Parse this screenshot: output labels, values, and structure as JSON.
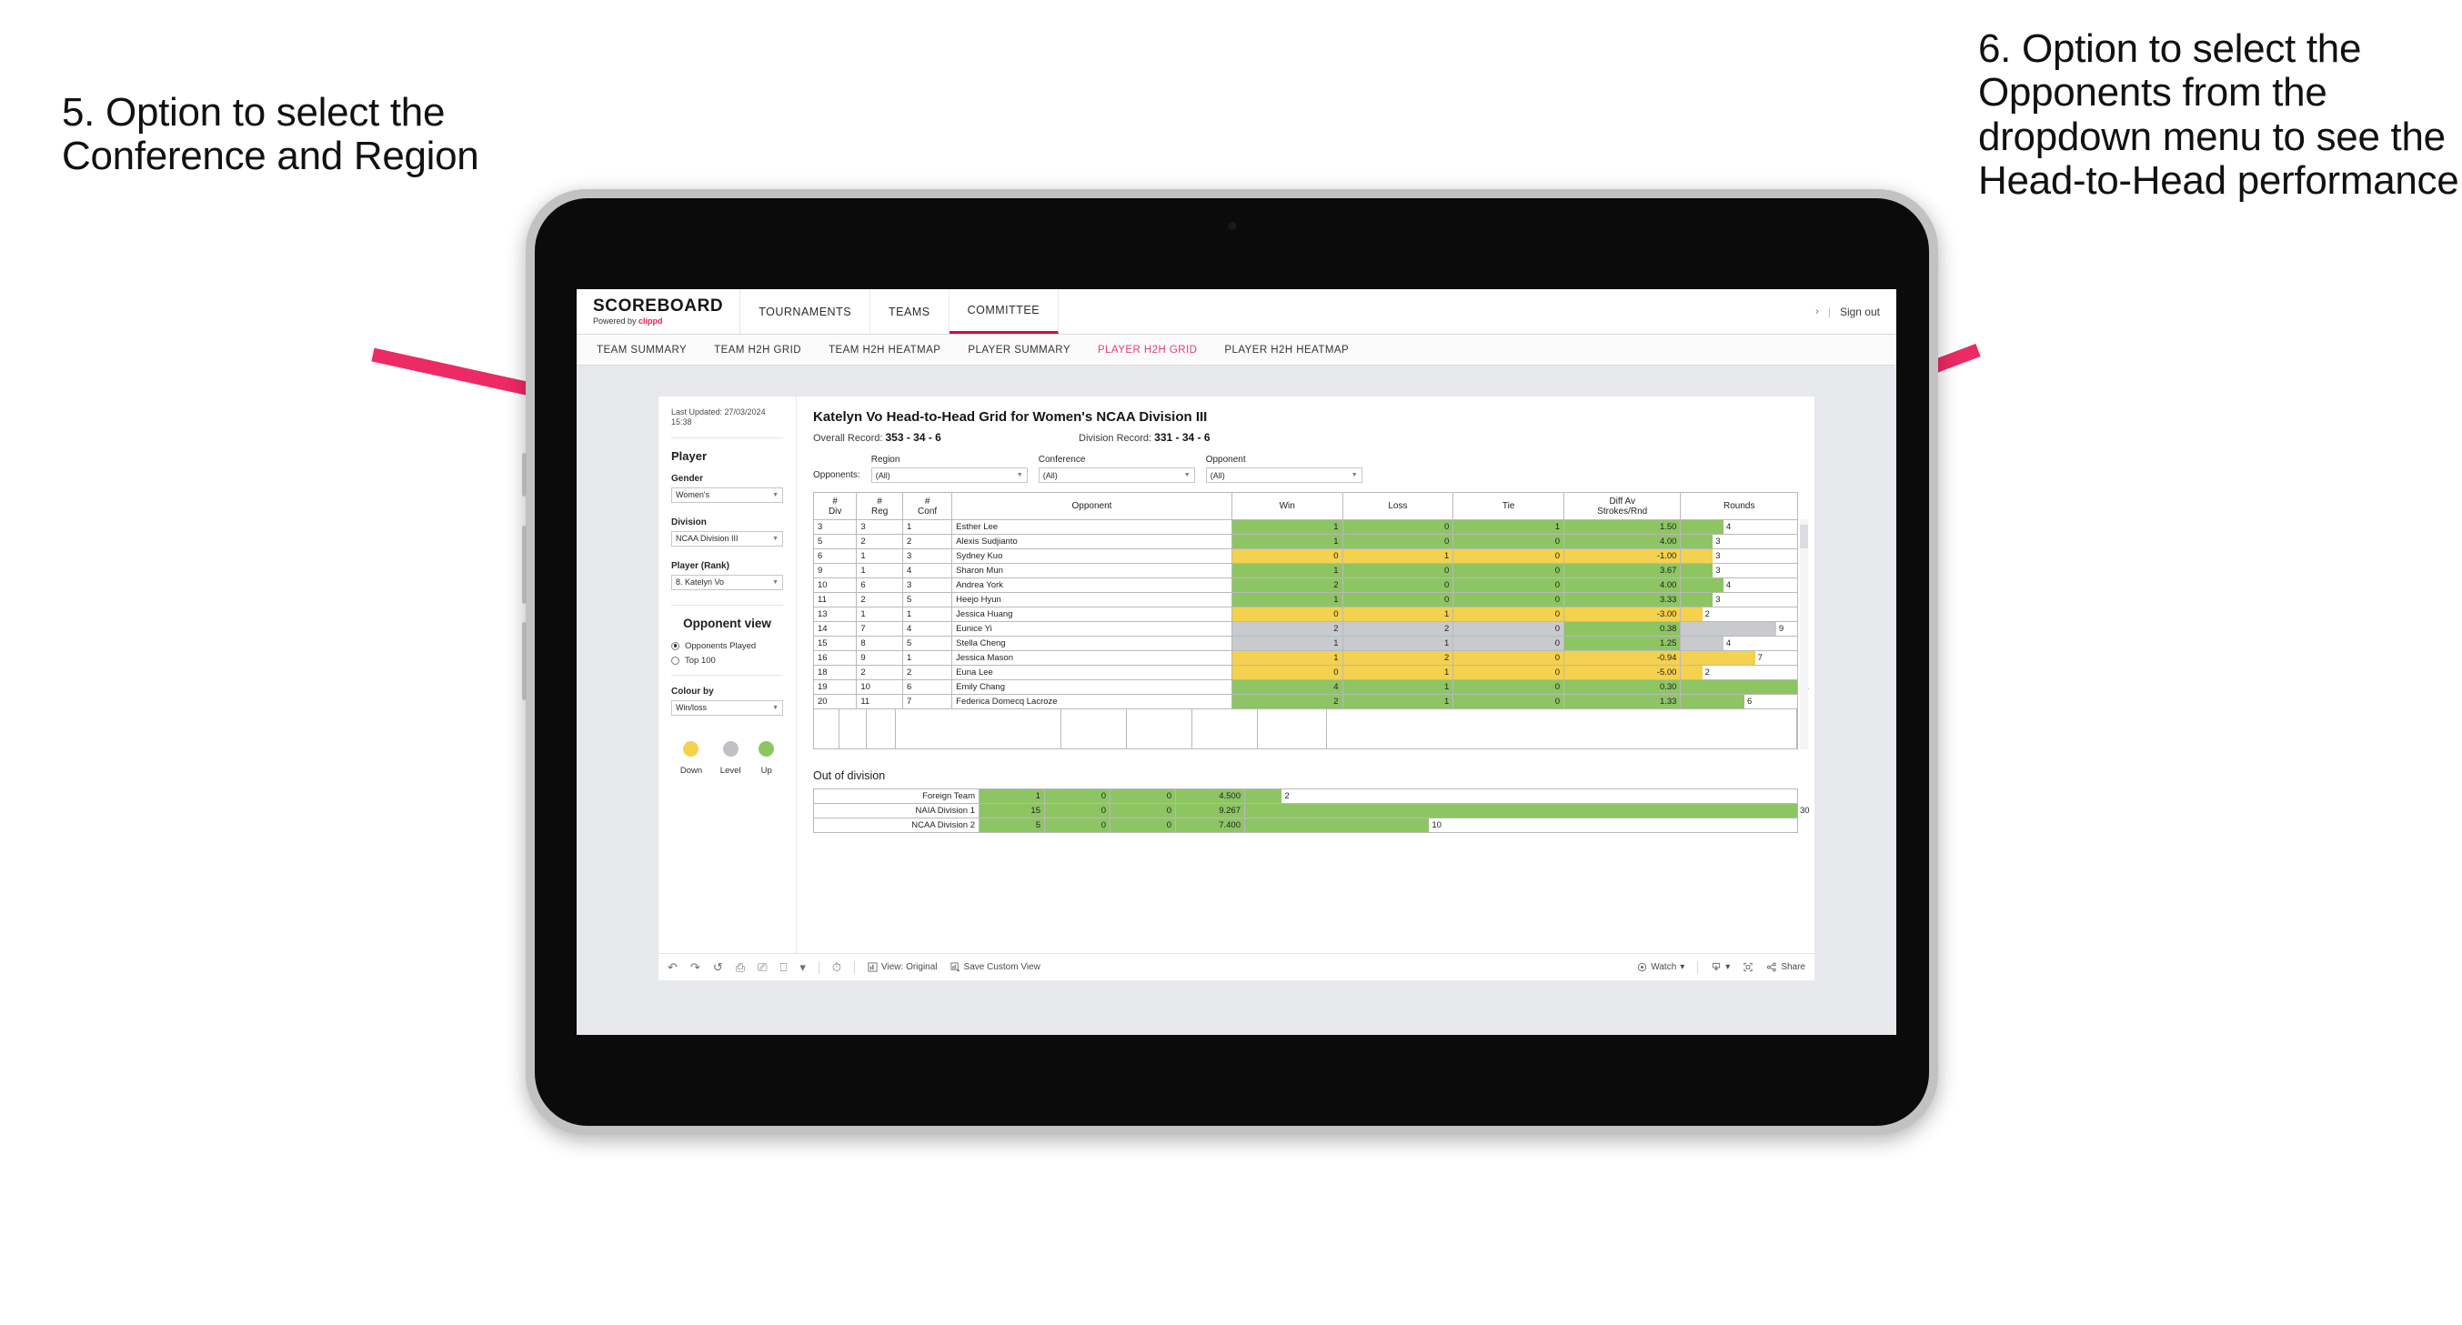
{
  "annotations": {
    "left": "5. Option to select the Conference and Region",
    "right": "6. Option to select the Opponents from the dropdown menu to see the Head-to-Head performance",
    "arrow_color": "#ec2a63"
  },
  "app": {
    "brand": {
      "name": "SCOREBOARD",
      "powered_prefix": "Powered by ",
      "powered_brand": "clippd"
    },
    "topnav": [
      {
        "label": "TOURNAMENTS",
        "active": false
      },
      {
        "label": "TEAMS",
        "active": false
      },
      {
        "label": "COMMITTEE",
        "active": true
      }
    ],
    "account": {
      "chevron": "›",
      "separator": "|",
      "sign_out": "Sign out"
    },
    "subnav": [
      {
        "label": "TEAM SUMMARY",
        "active": false
      },
      {
        "label": "TEAM H2H GRID",
        "active": false
      },
      {
        "label": "TEAM H2H HEATMAP",
        "active": false
      },
      {
        "label": "PLAYER SUMMARY",
        "active": false
      },
      {
        "label": "PLAYER H2H GRID",
        "active": true
      },
      {
        "label": "PLAYER H2H HEATMAP",
        "active": false
      }
    ]
  },
  "sidebar": {
    "last_updated": "Last Updated: 27/03/2024 15:38",
    "player_heading": "Player",
    "gender": {
      "label": "Gender",
      "value": "Women's"
    },
    "division": {
      "label": "Division",
      "value": "NCAA Division III"
    },
    "player_rank": {
      "label": "Player (Rank)",
      "value": "8. Katelyn Vo"
    },
    "opponent_view": {
      "heading": "Opponent view",
      "options": [
        {
          "label": "Opponents Played",
          "selected": true
        },
        {
          "label": "Top 100",
          "selected": false
        }
      ]
    },
    "colour_by": {
      "label": "Colour by",
      "value": "Win/loss"
    },
    "legend": [
      {
        "label": "Down",
        "color": "#f4d14e"
      },
      {
        "label": "Level",
        "color": "#bfc0c4"
      },
      {
        "label": "Up",
        "color": "#8dc563"
      }
    ]
  },
  "panel": {
    "title": "Katelyn Vo Head-to-Head Grid for Women's NCAA Division III",
    "overall_label": "Overall Record:",
    "overall_value": "353 - 34 - 6",
    "division_label": "Division Record:",
    "division_value": "331 - 34 - 6",
    "opponents_label": "Opponents:",
    "filters": [
      {
        "label": "Region",
        "value": "(All)"
      },
      {
        "label": "Conference",
        "value": "(All)"
      },
      {
        "label": "Opponent",
        "value": "(All)"
      }
    ]
  },
  "chart_data": {
    "type": "table",
    "title": "Katelyn Vo Head-to-Head Grid for Women's NCAA Division III",
    "columns": [
      "# Div",
      "# Reg",
      "# Conf",
      "Opponent",
      "Win",
      "Loss",
      "Tie",
      "Diff Av Strokes/Rnd",
      "Rounds"
    ],
    "header_lines": {
      "div": [
        "#",
        "Div"
      ],
      "reg": [
        "#",
        "Reg"
      ],
      "conf": [
        "#",
        "Conf"
      ],
      "opponent": [
        "Opponent"
      ],
      "win": [
        "Win"
      ],
      "loss": [
        "Loss"
      ],
      "tie": [
        "Tie"
      ],
      "diff": [
        "Diff Av",
        "Strokes/Rnd"
      ],
      "rounds": [
        "Rounds"
      ]
    },
    "rounds_max": 11,
    "colors": {
      "up": "#8dc563",
      "down": "#f4d14e",
      "level": "#c9cace"
    },
    "rows": [
      {
        "div": "3",
        "reg": "3",
        "conf": "1",
        "opponent": "Esther Lee",
        "win": "1",
        "loss": "0",
        "tie": "1",
        "diff": "1.50",
        "rounds": "4",
        "rounds_n": 4,
        "state": "up"
      },
      {
        "div": "5",
        "reg": "2",
        "conf": "2",
        "opponent": "Alexis Sudjianto",
        "win": "1",
        "loss": "0",
        "tie": "0",
        "diff": "4.00",
        "rounds": "3",
        "rounds_n": 3,
        "state": "up"
      },
      {
        "div": "6",
        "reg": "1",
        "conf": "3",
        "opponent": "Sydney Kuo",
        "win": "0",
        "loss": "1",
        "tie": "0",
        "diff": "-1.00",
        "rounds": "3",
        "rounds_n": 3,
        "state": "down"
      },
      {
        "div": "9",
        "reg": "1",
        "conf": "4",
        "opponent": "Sharon Mun",
        "win": "1",
        "loss": "0",
        "tie": "0",
        "diff": "3.67",
        "rounds": "3",
        "rounds_n": 3,
        "state": "up"
      },
      {
        "div": "10",
        "reg": "6",
        "conf": "3",
        "opponent": "Andrea York",
        "win": "2",
        "loss": "0",
        "tie": "0",
        "diff": "4.00",
        "rounds": "4",
        "rounds_n": 4,
        "state": "up"
      },
      {
        "div": "11",
        "reg": "2",
        "conf": "5",
        "opponent": "Heejo Hyun",
        "win": "1",
        "loss": "0",
        "tie": "0",
        "diff": "3.33",
        "rounds": "3",
        "rounds_n": 3,
        "state": "up"
      },
      {
        "div": "13",
        "reg": "1",
        "conf": "1",
        "opponent": "Jessica Huang",
        "win": "0",
        "loss": "1",
        "tie": "0",
        "diff": "-3.00",
        "rounds": "2",
        "rounds_n": 2,
        "state": "down"
      },
      {
        "div": "14",
        "reg": "7",
        "conf": "4",
        "opponent": "Eunice Yi",
        "win": "2",
        "loss": "2",
        "tie": "0",
        "diff": "0.38",
        "rounds": "9",
        "rounds_n": 9,
        "state": "level",
        "diff_state": "up"
      },
      {
        "div": "15",
        "reg": "8",
        "conf": "5",
        "opponent": "Stella Cheng",
        "win": "1",
        "loss": "1",
        "tie": "0",
        "diff": "1.25",
        "rounds": "4",
        "rounds_n": 4,
        "state": "level",
        "diff_state": "up"
      },
      {
        "div": "16",
        "reg": "9",
        "conf": "1",
        "opponent": "Jessica Mason",
        "win": "1",
        "loss": "2",
        "tie": "0",
        "diff": "-0.94",
        "rounds": "7",
        "rounds_n": 7,
        "state": "down"
      },
      {
        "div": "18",
        "reg": "2",
        "conf": "2",
        "opponent": "Euna Lee",
        "win": "0",
        "loss": "1",
        "tie": "0",
        "diff": "-5.00",
        "rounds": "2",
        "rounds_n": 2,
        "state": "down"
      },
      {
        "div": "19",
        "reg": "10",
        "conf": "6",
        "opponent": "Emily Chang",
        "win": "4",
        "loss": "1",
        "tie": "0",
        "diff": "0.30",
        "rounds": "11",
        "rounds_n": 11,
        "state": "up"
      },
      {
        "div": "20",
        "reg": "11",
        "conf": "7",
        "opponent": "Federica Domecq Lacroze",
        "win": "2",
        "loss": "1",
        "tie": "0",
        "diff": "1.33",
        "rounds": "6",
        "rounds_n": 6,
        "state": "up"
      }
    ],
    "out_of_division": {
      "title": "Out of division",
      "rounds_max": 30,
      "rows": [
        {
          "name": "Foreign Team",
          "win": "1",
          "loss": "0",
          "tie": "0",
          "diff": "4.500",
          "rounds": "2",
          "rounds_n": 2,
          "state": "up"
        },
        {
          "name": "NAIA Division 1",
          "win": "15",
          "loss": "0",
          "tie": "0",
          "diff": "9.267",
          "rounds": "30",
          "rounds_n": 30,
          "state": "up"
        },
        {
          "name": "NCAA Division 2",
          "win": "5",
          "loss": "0",
          "tie": "0",
          "diff": "7.400",
          "rounds": "10",
          "rounds_n": 10,
          "state": "up"
        }
      ]
    }
  },
  "toolbar": {
    "view_label": "View: Original",
    "save_label": "Save Custom View",
    "watch_label": "Watch",
    "share_label": "Share",
    "caret": "▾"
  }
}
